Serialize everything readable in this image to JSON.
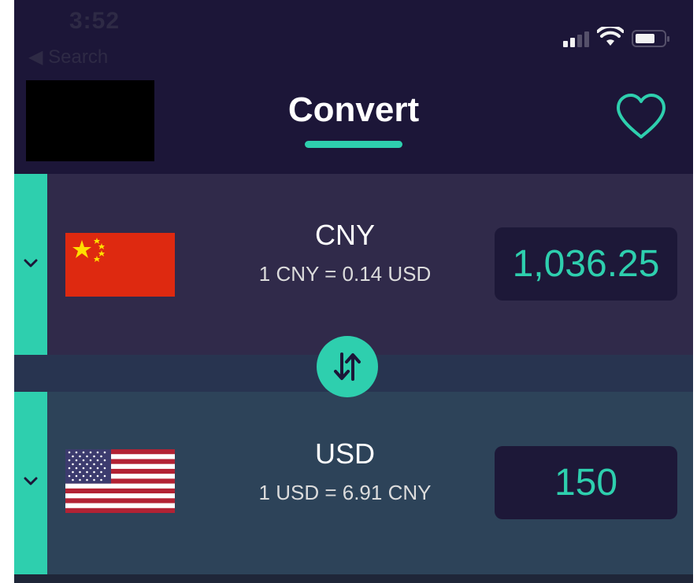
{
  "status_bar": {
    "time": "3:52",
    "back_label": "◀ Search"
  },
  "header": {
    "title": "Convert",
    "favorite_icon": "heart-icon"
  },
  "colors": {
    "accent": "#2ecfae",
    "background": "#1c1638",
    "top_row": "#302a4a",
    "bottom_row": "#2d4359"
  },
  "converter": {
    "from": {
      "code": "CNY",
      "rate": "1 CNY = 0.14 USD",
      "amount": "1,036.25",
      "flag": "china-flag"
    },
    "to": {
      "code": "USD",
      "rate": "1 USD = 6.91 CNY",
      "amount": "150",
      "flag": "us-flag"
    },
    "swap_icon": "swap-arrows-icon",
    "expand_icon": "chevron-down-icon"
  }
}
